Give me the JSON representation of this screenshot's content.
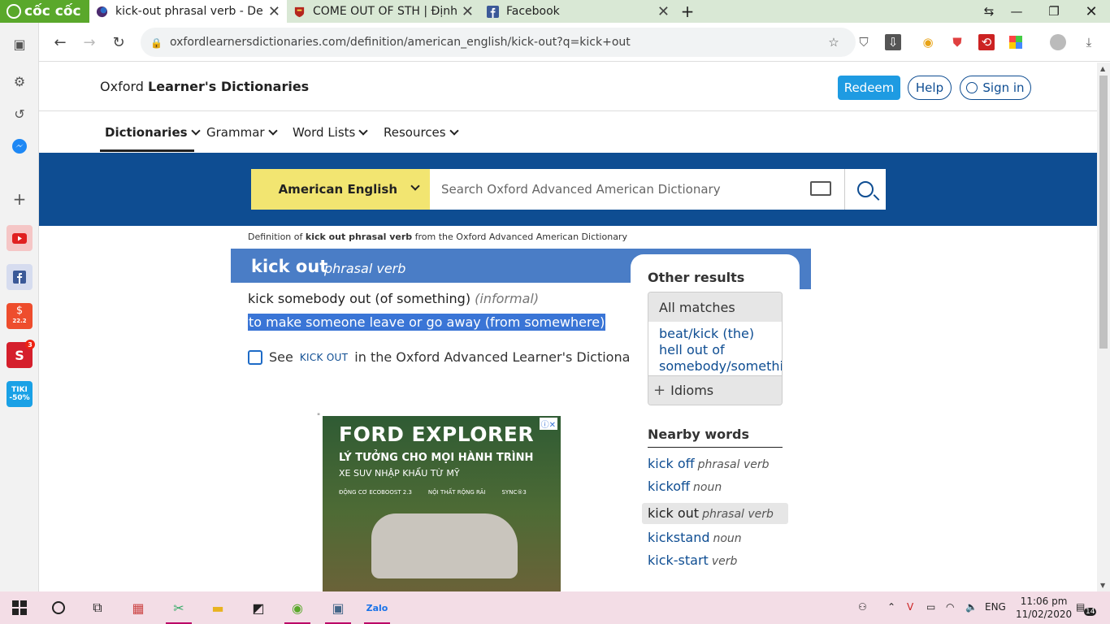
{
  "browser": {
    "logo_text": "cốc cốc",
    "tabs": [
      {
        "title": "kick-out phrasal verb - Definiti",
        "active": true
      },
      {
        "title": "COME OUT OF STH | Định ngh",
        "active": false
      },
      {
        "title": "Facebook",
        "active": false
      }
    ],
    "new_tab": "+",
    "url": "oxfordlearnersdictionaries.com/definition/american_english/kick-out?q=kick+out"
  },
  "sidebar": {
    "items": [
      "settings-icon",
      "history-icon",
      "messenger-icon",
      "add-icon",
      "youtube-icon",
      "facebook-icon",
      "shopee-icon",
      "sendo-icon",
      "tiki-icon"
    ],
    "shopee_badge": "22.2",
    "sendo_badge": "3",
    "tiki_label": "TIKI",
    "tiki_discount": "-50%"
  },
  "site": {
    "brand_prefix": "Oxford ",
    "brand_bold": "Learner's Dictionaries",
    "redeem": "Redeem",
    "help": "Help",
    "sign_in": "Sign in",
    "nav": [
      "Dictionaries",
      "Grammar",
      "Word Lists",
      "Resources"
    ],
    "dict_select": "American English",
    "search_placeholder": "Search Oxford Advanced American Dictionary"
  },
  "entry": {
    "definition_of_prefix": "Definition of ",
    "definition_of_bold": "kick out phrasal verb",
    "definition_of_suffix": " from the Oxford Advanced American Dictionary",
    "headword": "kick out",
    "pos": "phrasal verb",
    "pattern": "kick somebody out (of something)",
    "register_open": " (",
    "register": "informal",
    "register_close": ")",
    "definition": "to make someone leave or go away (from somewhere)",
    "see_prefix": "See",
    "see_link": "KICK OUT",
    "see_suffix": "in the Oxford Advanced Learner's Dictionary"
  },
  "ad": {
    "headline": "FORD EXPLORER",
    "tagline": "LÝ TƯỞNG CHO MỌI HÀNH TRÌNH",
    "subline": "XE SUV NHẬP KHẨU TỪ MỸ",
    "features": [
      "ĐỘNG CƠ ECOBOOST 2.3",
      "NỘI THẤT RỘNG RÃI",
      "SYNC®3"
    ],
    "badge": "ⓘ✕"
  },
  "sidebar_results": {
    "other_results": "Other results",
    "all_matches": "All matches",
    "matches": [
      "beat/kick (the)",
      "hell out of",
      "somebody/somethin"
    ],
    "idioms": "Idioms",
    "nearby_title": "Nearby words",
    "nearby": [
      {
        "word": "kick off",
        "pos": "phrasal verb",
        "current": false
      },
      {
        "word": "kickoff",
        "pos": "noun",
        "current": false
      },
      {
        "word": "kick out",
        "pos": "phrasal verb",
        "current": true
      },
      {
        "word": "kickstand",
        "pos": "noun",
        "current": false
      },
      {
        "word": "kick-start",
        "pos": "verb",
        "current": false
      }
    ]
  },
  "taskbar": {
    "lang": "ENG",
    "time": "11:06 pm",
    "date": "11/02/2020",
    "notif_count": "14"
  },
  "colors": {
    "oxford_blue": "#0e4d92",
    "entry_blue": "#4a7dc6",
    "selector_yellow": "#f2e571",
    "redeem_blue": "#1e9be2",
    "coccoc_green": "#5aa82b"
  }
}
